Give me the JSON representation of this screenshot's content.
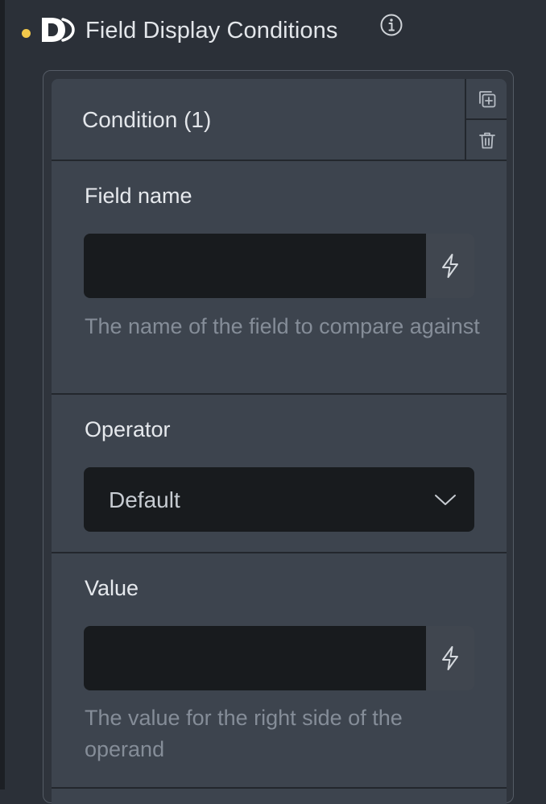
{
  "header": {
    "title": "Field Display Conditions",
    "status_dot_color": "#f3c94b",
    "logo_icon": "d-logo-icon",
    "info_icon": "info-icon"
  },
  "condition": {
    "title": "Condition (1)",
    "duplicate_icon": "copy-plus-icon",
    "delete_icon": "trash-icon"
  },
  "fields": {
    "field_name": {
      "label": "Field name",
      "value": "",
      "help": "The name of the field to compare against",
      "dynamic_icon": "lightning-icon"
    },
    "operator": {
      "label": "Operator",
      "selected": "Default",
      "icon": "chevron-down-icon"
    },
    "value": {
      "label": "Value",
      "value": "",
      "help": "The value for the right side of the operand",
      "dynamic_icon": "lightning-icon"
    }
  },
  "colors": {
    "panel_bg": "#2b3038",
    "card_bg": "#3d444e",
    "input_bg": "#181b1e",
    "text_primary": "#e3e6ea",
    "text_help": "#858d98"
  }
}
